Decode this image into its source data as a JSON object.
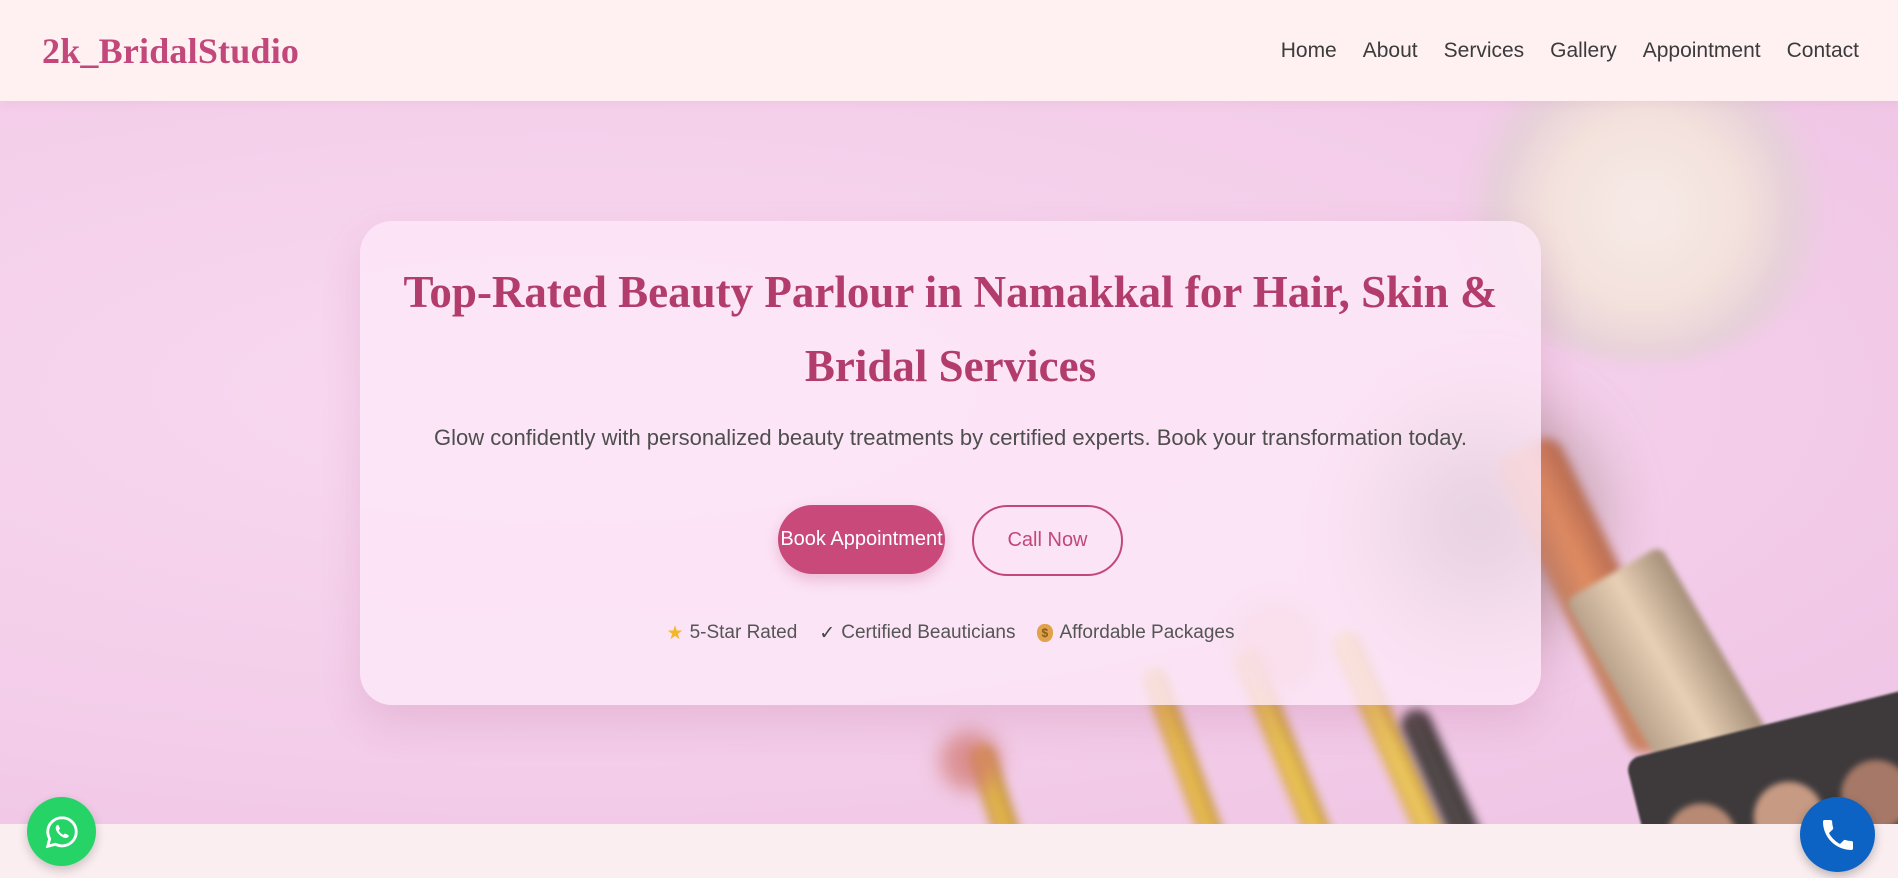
{
  "brand": {
    "name": "2k_BridalStudio"
  },
  "nav": {
    "items": [
      {
        "label": "Home"
      },
      {
        "label": "About"
      },
      {
        "label": "Services"
      },
      {
        "label": "Gallery"
      },
      {
        "label": "Appointment"
      },
      {
        "label": "Contact"
      }
    ]
  },
  "hero": {
    "title": "Top-Rated Beauty Parlour in Namakkal for Hair, Skin & Bridal Services",
    "subtitle": "Glow confidently with personalized beauty treatments by certified experts. Book your transformation today.",
    "primary_cta": "Book Appointment",
    "secondary_cta": "Call Now",
    "badges": [
      {
        "icon": "star-icon",
        "label": "5-Star Rated"
      },
      {
        "icon": "check-icon",
        "label": "Certified Beauticians"
      },
      {
        "icon": "money-bag-icon",
        "label": "Affordable Packages"
      }
    ]
  },
  "floating": {
    "whatsapp_icon": "whatsapp-icon",
    "call_icon": "phone-icon"
  },
  "colors": {
    "brand": "#c2477a",
    "primary_button": "#c9497b",
    "header_bg": "#fff1f2",
    "whatsapp": "#25d366",
    "call": "#0d63c4"
  }
}
